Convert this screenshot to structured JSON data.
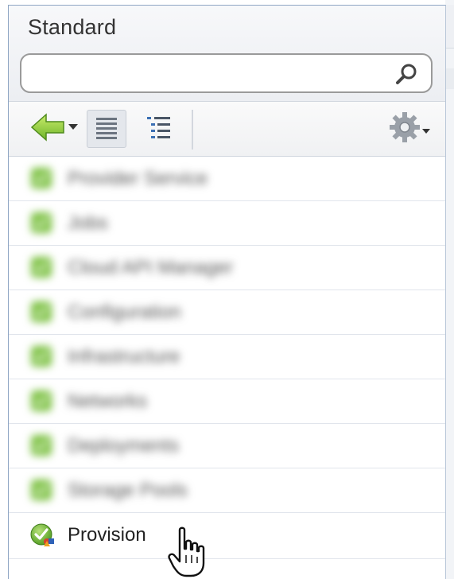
{
  "panel": {
    "title": "Standard"
  },
  "search": {
    "value": "",
    "placeholder": "",
    "icon": "search-icon"
  },
  "toolbar": {
    "back_icon": "back-arrow-icon",
    "list_view_icon": "list-view-icon",
    "tree_view_icon": "tree-view-icon",
    "settings_icon": "gear-icon"
  },
  "list": {
    "items": [
      {
        "label": "Provider Service",
        "icon": "green-check-icon",
        "blurred": true
      },
      {
        "label": "Jobs",
        "icon": "green-check-icon",
        "blurred": true
      },
      {
        "label": "Cloud API Manager",
        "icon": "green-check-icon",
        "blurred": true
      },
      {
        "label": "Configuration",
        "icon": "green-check-icon",
        "blurred": true
      },
      {
        "label": "Infrastructure",
        "icon": "green-check-icon",
        "blurred": true
      },
      {
        "label": "Networks",
        "icon": "green-check-icon",
        "blurred": true
      },
      {
        "label": "Deployments",
        "icon": "green-check-icon",
        "blurred": true
      },
      {
        "label": "Storage Pools",
        "icon": "green-check-icon",
        "blurred": true
      },
      {
        "label": "Provision",
        "icon": "provision-check-icon",
        "blurred": false
      }
    ]
  },
  "colors": {
    "accent_green": "#6ab83a",
    "border_blue": "#8fa6c4"
  },
  "cursor": {
    "icon": "hand-pointer-icon"
  }
}
